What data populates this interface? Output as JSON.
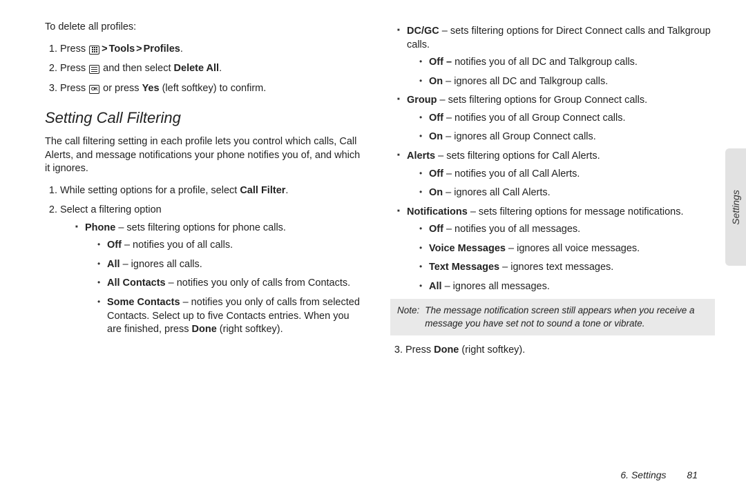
{
  "left": {
    "delete_heading": "To delete all profiles:",
    "delete_steps": {
      "s1_press": "Press",
      "s1_tools": "Tools",
      "s1_profiles": "Profiles",
      "s2_press": "Press",
      "s2_then": "and then select",
      "s2_deleteall": "Delete All",
      "s3_press": "Press",
      "s3_or": "or press",
      "s3_yes": "Yes",
      "s3_rest": "(left softkey) to confirm."
    },
    "filter_heading": "Setting Call Filtering",
    "filter_intro": "The call filtering setting in each profile lets you control which calls, Call Alerts, and message notifications your phone notifies you of, and which it ignores.",
    "filter_steps": {
      "s1_a": "While setting options for a profile, select",
      "s1_cf": "Call Filter",
      "s2": "Select a filtering option"
    },
    "phone": {
      "label": "Phone",
      "desc": "– sets filtering options for phone calls.",
      "off_l": "Off",
      "off_d": "– notifies you of all calls.",
      "all_l": "All",
      "all_d": "– ignores all calls.",
      "ac_l": "All Contacts",
      "ac_d": "– notifies you only of calls from Contacts.",
      "sc_l": "Some Contacts",
      "sc_d1": "– notifies you only of calls from selected Contacts. Select up to five Contacts entries. When you are finished, press",
      "sc_done": "Done",
      "sc_d2": "(right softkey)."
    }
  },
  "right": {
    "dcgc": {
      "label": "DC/GC",
      "desc": "– sets filtering options for Direct Connect calls and Talkgroup calls.",
      "off_l": "Off –",
      "off_d": "notifies you of all DC and Talkgroup calls.",
      "on_l": "On",
      "on_d": "– ignores all DC and Talkgroup calls."
    },
    "group": {
      "label": "Group",
      "desc": "– sets filtering options for Group Connect calls.",
      "off_l": "Off",
      "off_d": "– notifies you of all Group Connect calls.",
      "on_l": "On",
      "on_d": "– ignores all Group Connect calls."
    },
    "alerts": {
      "label": "Alerts",
      "desc": "– sets filtering options for Call Alerts.",
      "off_l": "Off",
      "off_d": "– notifies you of all Call Alerts.",
      "on_l": "On",
      "on_d": "– ignores all Call Alerts."
    },
    "notifications": {
      "label": "Notifications",
      "desc": "– sets filtering options for message notifications.",
      "off_l": "Off",
      "off_d": "– notifies you of all messages.",
      "vm_l": "Voice Messages",
      "vm_d": "– ignores all voice messages.",
      "tm_l": "Text Messages",
      "tm_d": "– ignores text messages.",
      "all_l": "All",
      "all_d": "– ignores all messages."
    },
    "note_label": "Note:",
    "note_text": "The message notification screen still appears when you receive a message you have set not to sound a tone or vibrate.",
    "step3_a": "Press",
    "step3_done": "Done",
    "step3_b": "(right softkey)."
  },
  "side_tab": "Settings",
  "footer_section": "6. Settings",
  "footer_page": "81"
}
